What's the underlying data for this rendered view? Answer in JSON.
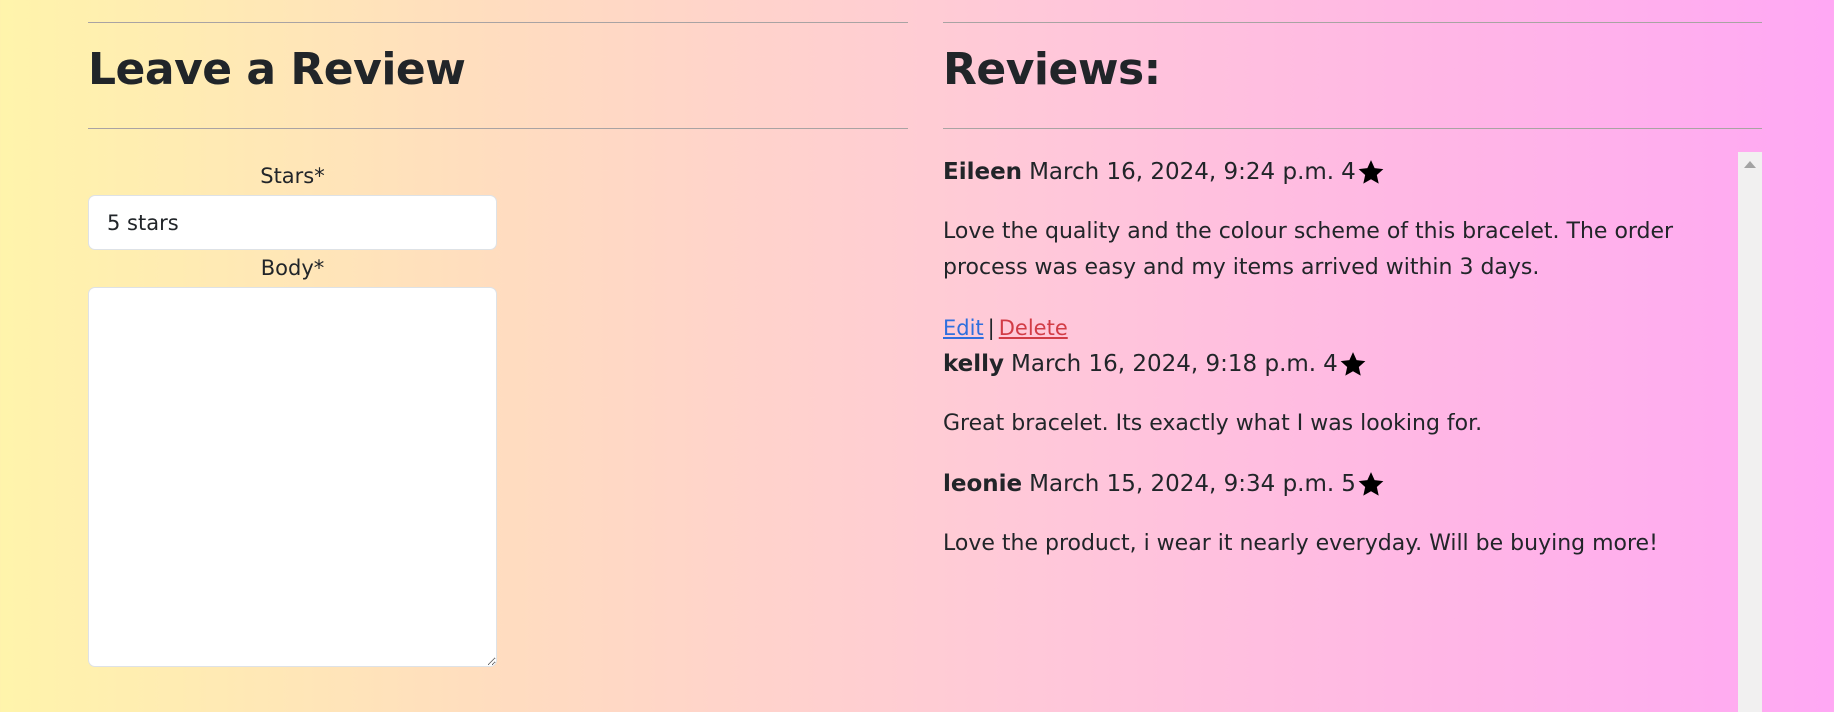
{
  "review_form": {
    "title": "Leave a Review",
    "stars_label": "Stars*",
    "stars_value": "5 stars",
    "body_label": "Body*",
    "body_value": ""
  },
  "reviews_section": {
    "title": "Reviews:",
    "edit_label": "Edit",
    "separator": "|",
    "delete_label": "Delete",
    "star_icon": "star-icon",
    "items": [
      {
        "author": "Eileen",
        "date": "March 16, 2024, 9:24 p.m.",
        "rating": "4",
        "body": "Love the quality and the colour scheme of this bracelet. The order process was easy and my items arrived within 3 days."
      },
      {
        "author": "kelly",
        "date": "March 16, 2024, 9:18 p.m.",
        "rating": "4",
        "body": "Great bracelet. Its exactly what I was looking for."
      },
      {
        "author": "leonie",
        "date": "March 15, 2024, 9:34 p.m.",
        "rating": "5",
        "body": "Love the product, i wear it nearly everyday. Will be buying more!"
      }
    ]
  },
  "colors": {
    "gradient_start": "#fff4ab",
    "gradient_end": "#ffa8f4",
    "link_edit": "#2f6fde",
    "link_delete": "#d23c46",
    "text": "#212529"
  }
}
